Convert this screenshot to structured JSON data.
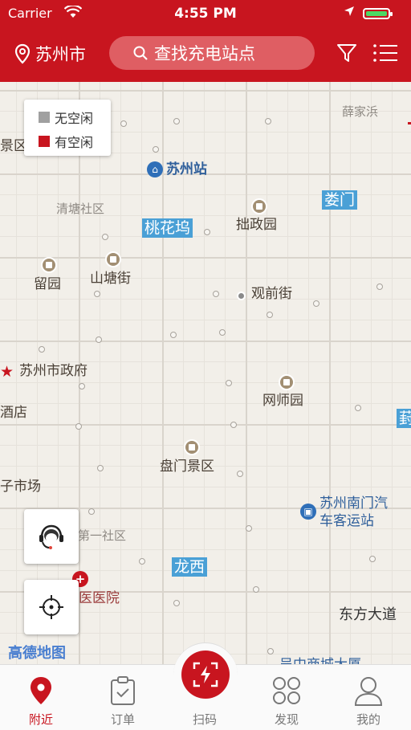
{
  "status_bar": {
    "carrier": "Carrier",
    "time": "4:55 PM",
    "battery_level": 1.0,
    "battery_color": "#4cd964"
  },
  "nav": {
    "city": "苏州市",
    "search_placeholder": "查找充电站点"
  },
  "legend": {
    "items": [
      {
        "label": "无空闲",
        "color": "#a0a0a0"
      },
      {
        "label": "有空闲",
        "color": "#c8151f"
      }
    ]
  },
  "map": {
    "labels": {
      "xuejiabang": "薛家浜",
      "jing": "景区",
      "suzhou_station": "苏州站",
      "qingtang": "清塘社区",
      "loumen": "娄门",
      "taohuawu": "桃花坞",
      "zhuozheng": "拙政园",
      "liuyuan": "留园",
      "shantang": "山塘街",
      "guanqian": "观前街",
      "gov": "苏州市政府",
      "wangshi": "网师园",
      "hotel": "酒店",
      "feng": "葑",
      "panmen": "盘门景区",
      "market": "子市场",
      "bus_station_1": "苏州南门汽",
      "bus_station_2": "车客运站",
      "community": "星第一社区",
      "longxi": "龙西",
      "hospital": "苏州市中医医院",
      "dongfang": "东方大道",
      "bottom_cut": "吴中商城大厦"
    },
    "logo": "高德地图"
  },
  "tabs": [
    {
      "label": "附近",
      "icon": "location-pin-icon",
      "active": true
    },
    {
      "label": "订单",
      "icon": "clipboard-icon",
      "active": false
    },
    {
      "label": "扫码",
      "icon": "scan-charge-icon",
      "active": false
    },
    {
      "label": "发现",
      "icon": "discover-grid-icon",
      "active": false
    },
    {
      "label": "我的",
      "icon": "profile-icon",
      "active": false
    }
  ],
  "colors": {
    "brand": "#c8151f",
    "metro": "#4aa0d6",
    "map_bg": "#f2efe9"
  }
}
